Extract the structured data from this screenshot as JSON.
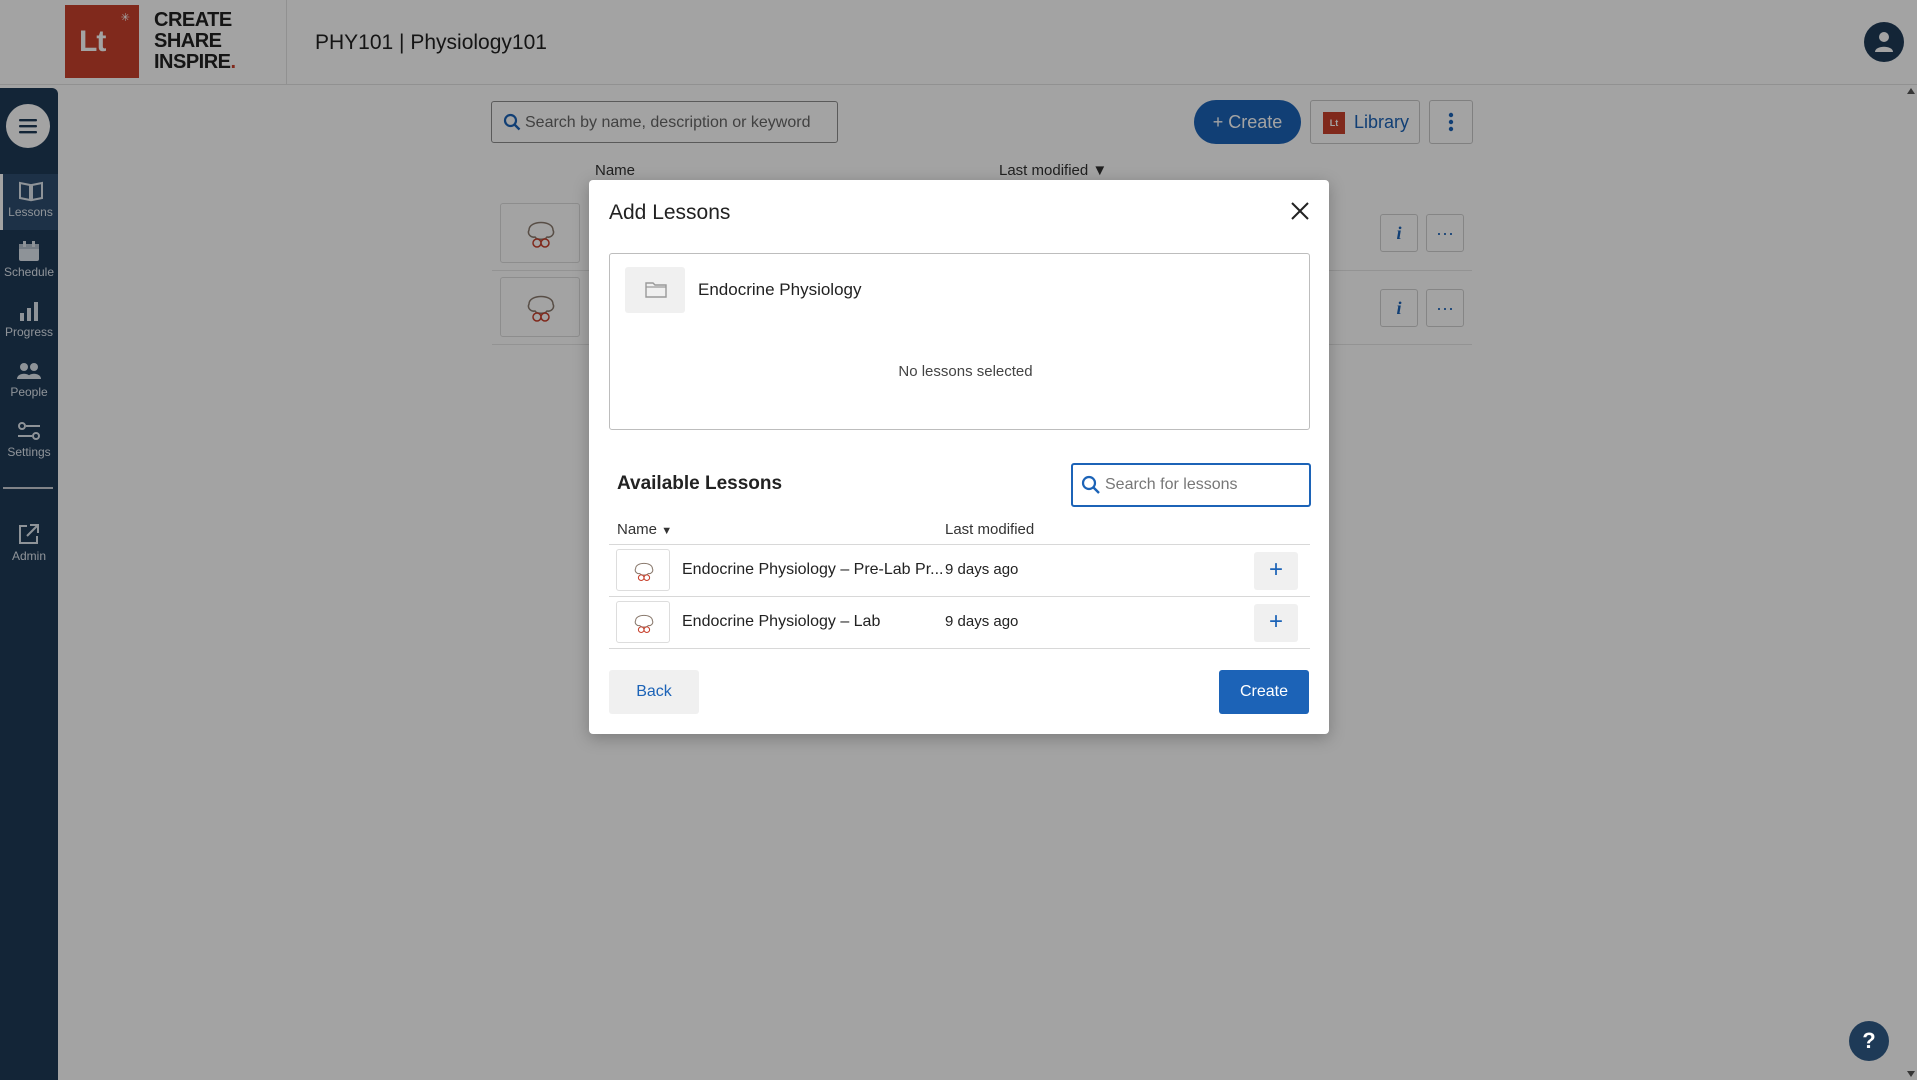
{
  "header": {
    "logo_text": "Lt",
    "tagline": [
      "CREATE",
      "SHARE",
      "INSPIRE"
    ],
    "tagline_dot": ".",
    "course_title": "PHY101 | Physiology101"
  },
  "sidebar": {
    "menu_icon": "hamburger-icon",
    "items": [
      {
        "label": "Lessons",
        "icon": "book-icon",
        "active": true
      },
      {
        "label": "Schedule",
        "icon": "calendar-icon"
      },
      {
        "label": "Progress",
        "icon": "bar-chart-icon"
      },
      {
        "label": "People",
        "icon": "people-icon"
      },
      {
        "label": "Settings",
        "icon": "sliders-icon"
      },
      {
        "label": "Admin",
        "icon": "external-link-icon"
      }
    ]
  },
  "main": {
    "search_placeholder": "Search by name, description or keyword",
    "create_label": "+ Create",
    "library_label": "Library",
    "library_logo": "Lt",
    "columns": {
      "name": "Name",
      "last_modified": "Last modified ▼"
    }
  },
  "modal": {
    "title": "Add Lessons",
    "folder_name": "Endocrine Physiology",
    "no_selection": "No lessons selected",
    "available_title": "Available Lessons",
    "search_placeholder": "Search for lessons",
    "search_value": "",
    "columns": {
      "name": "Name",
      "sort_indicator": "▼",
      "last_modified": "Last modified"
    },
    "lessons": [
      {
        "name": "Endocrine Physiology – Pre-Lab Pr...",
        "modified": "9 days ago",
        "add": "+"
      },
      {
        "name": "Endocrine Physiology – Lab",
        "modified": "9 days ago",
        "add": "+"
      }
    ],
    "back_label": "Back",
    "create_label": "Create"
  },
  "help": {
    "label": "?"
  },
  "colors": {
    "brand_red": "#c8402c",
    "primary_blue": "#1c63b7",
    "sidebar_navy": "#1e3a57"
  }
}
